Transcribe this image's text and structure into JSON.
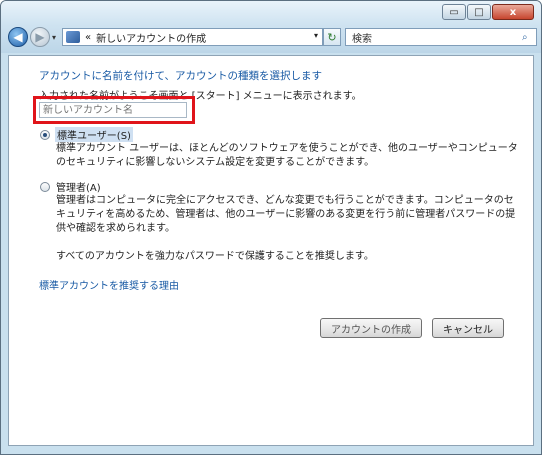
{
  "window": {
    "caption_buttons": {
      "minimize": "▭",
      "maximize": "□",
      "close": "x"
    }
  },
  "nav": {
    "back_glyph": "◀",
    "forward_glyph": "▶",
    "history_glyph": "▾",
    "address_sep": "«",
    "address_text": "新しいアカウントの作成",
    "address_drop_glyph": "▾",
    "refresh_glyph": "↻",
    "search_placeholder": "検索",
    "search_glyph": "⌕"
  },
  "page": {
    "heading": "アカウントに名前を付けて、アカウントの種類を選択します",
    "name_hint": "入力された名前がようこそ画面と [スタート] メニューに表示されます。",
    "name_placeholder": "新しいアカウント名",
    "standard": {
      "label": "標準ユーザー(S)",
      "checked": true,
      "desc_line1": "標準アカウント ユーザーは、ほとんどのソフトウェアを使うことができ、他のユーザーやコンピュータ",
      "desc_line2": "のセキュリティに影響しないシステム設定を変更することができます。"
    },
    "admin": {
      "label": "管理者(A)",
      "checked": false,
      "desc_line1": "管理者はコンピュータに完全にアクセスでき、どんな変更でも行うことができます。コンピュータのセ",
      "desc_line2": "キュリティを高めるため、管理者は、他のユーザーに影響のある変更を行う前に管理者パスワードの提",
      "desc_line3": "供や確認を求められます。"
    },
    "password_note": "すべてのアカウントを強力なパスワードで保護することを推奨します。",
    "why_link": "標準アカウントを推奨する理由",
    "create_button": "アカウントの作成",
    "cancel_button": "キャンセル"
  },
  "colors": {
    "highlight": "#e0141a",
    "link": "#1a5ba5"
  }
}
